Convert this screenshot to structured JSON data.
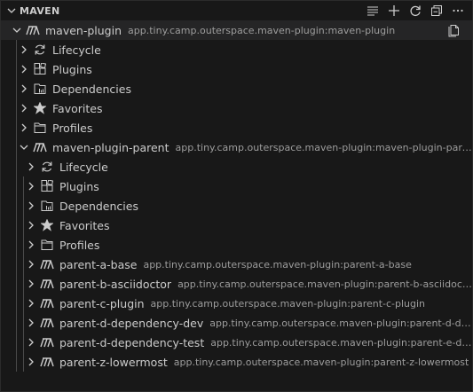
{
  "header": {
    "title": "MAVEN",
    "actions": [
      "list-icon",
      "add-icon",
      "refresh-icon",
      "collapse-all-icon",
      "more-icon"
    ]
  },
  "tree": {
    "root": {
      "label": "maven-plugin",
      "description": "app.tiny.camp.outerspace.maven-plugin:maven-plugin",
      "children": [
        "Lifecycle",
        "Plugins",
        "Dependencies",
        "Favorites",
        "Profiles"
      ]
    },
    "parent": {
      "label": "maven-plugin-parent",
      "description": "app.tiny.camp.outerspace.maven-plugin:maven-plugin-parent",
      "children": [
        "Lifecycle",
        "Plugins",
        "Dependencies",
        "Favorites",
        "Profiles"
      ]
    },
    "modules": [
      {
        "label": "parent-a-base",
        "description": "app.tiny.camp.outerspace.maven-plugin:parent-a-base"
      },
      {
        "label": "parent-b-asciidoctor",
        "description": "app.tiny.camp.outerspace.maven-plugin:parent-b-asciidoctor"
      },
      {
        "label": "parent-c-plugin",
        "description": "app.tiny.camp.outerspace.maven-plugin:parent-c-plugin"
      },
      {
        "label": "parent-d-dependency-dev",
        "description": "app.tiny.camp.outerspace.maven-plugin:parent-d-dep..."
      },
      {
        "label": "parent-d-dependency-test",
        "description": "app.tiny.camp.outerspace.maven-plugin:parent-e-dep..."
      },
      {
        "label": "parent-z-lowermost",
        "description": "app.tiny.camp.outerspace.maven-plugin:parent-z-lowermost"
      }
    ]
  }
}
